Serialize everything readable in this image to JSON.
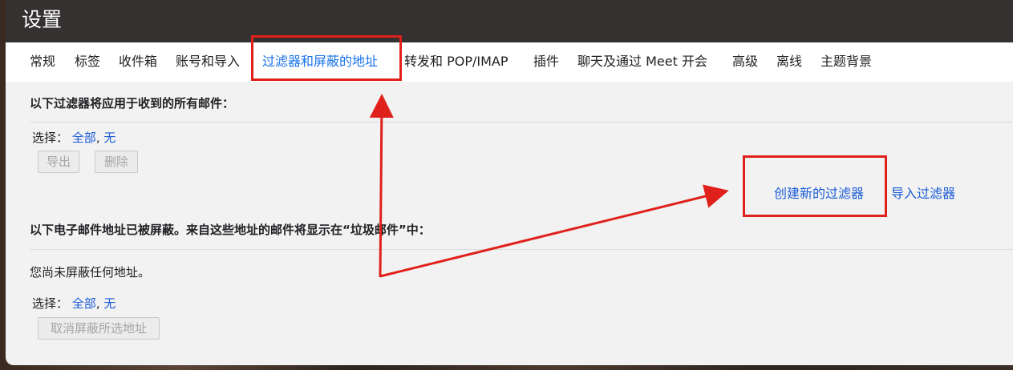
{
  "header": {
    "title": "设置"
  },
  "tabs": [
    {
      "label": "常规"
    },
    {
      "label": "标签"
    },
    {
      "label": "收件箱"
    },
    {
      "label": "账号和导入"
    },
    {
      "label": "过滤器和屏蔽的地址"
    },
    {
      "label": "转发和 POP/IMAP"
    },
    {
      "label": "插件"
    },
    {
      "label": "聊天及通过 Meet 开会"
    },
    {
      "label": "高级"
    },
    {
      "label": "离线"
    },
    {
      "label": "主题背景"
    }
  ],
  "active_tab": "过滤器和屏蔽的地址",
  "filters": {
    "heading": "以下过滤器将应用于收到的所有邮件：",
    "select_label": "选择：",
    "select_all": "全部",
    "separator": ",",
    "select_none": "无",
    "export_label": "导出",
    "delete_label": "删除",
    "create_filter_label": "创建新的过滤器",
    "import_filter_label": "导入过滤器"
  },
  "blocked": {
    "heading": "以下电子邮件地址已被屏蔽。来自这些地址的邮件将显示在“垃圾邮件”中：",
    "empty_text": "您尚未屏蔽任何地址。",
    "select_label": "选择：",
    "select_all": "全部",
    "separator": ",",
    "select_none": "无",
    "unblock_label": "取消屏蔽所选地址"
  },
  "colors": {
    "accent": "#1a73e8",
    "link": "#1a5bd6",
    "annotation": "#e0201a",
    "topbar": "#24211f"
  }
}
